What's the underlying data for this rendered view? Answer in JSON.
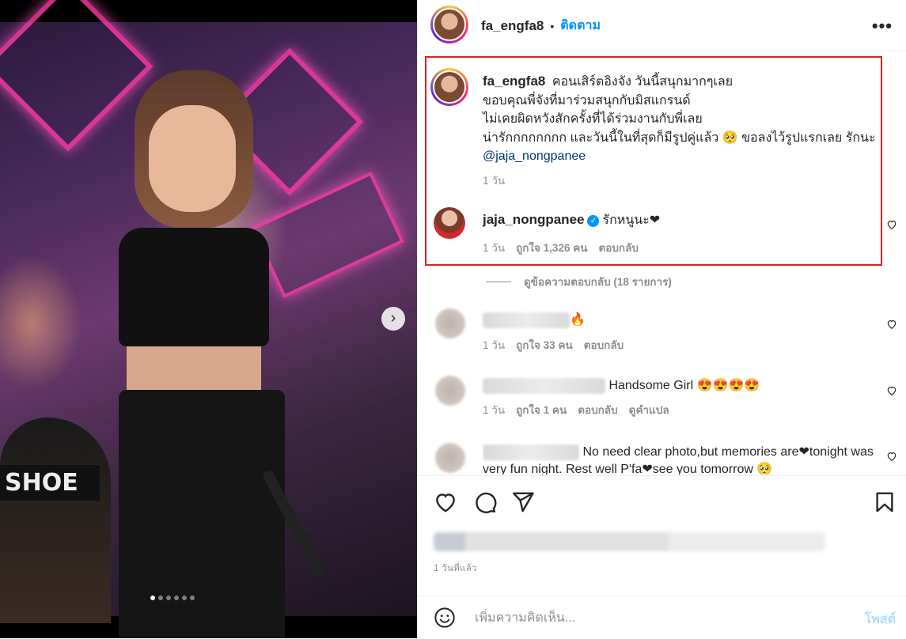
{
  "post": {
    "username": "fa_engfa8",
    "follow_label": "ติดตาม",
    "more_label": "•••",
    "header_dot": "•",
    "image_alt_text_hidden": "",
    "carousel": {
      "count": 6,
      "active": 0
    }
  },
  "caption": {
    "username": "fa_engfa8",
    "lines": [
      "คอนเสิร์ตอิงจัง วันนี้สนุกมากๆเลย",
      "ขอบคุณพี่จังที่มาร่วมสนุกกับมิสแกรนด์",
      "ไม่เคยผิดหวังสักครั้งที่ได้ร่วมงานกับพี่เลย",
      "น่ารักกกกกกกก และวันนี้ในที่สุดก็มีรูปคู่แล้ว 🥺 ขอลงไว้รูปแรกเลย รักนะ"
    ],
    "mention": "@jaja_nongpanee",
    "time": "1 วัน"
  },
  "pinned_comment": {
    "username": "jaja_nongpanee",
    "verified_mark": "✓",
    "text": "รักหนูนะ❤",
    "time": "1 วัน",
    "likes": "ถูกใจ 1,326 คน",
    "reply_label": "ตอบกลับ"
  },
  "view_replies": "ดูข้อความตอบกลับ (18 รายการ)",
  "comments": [
    {
      "text": "🔥",
      "time": "1 วัน",
      "likes": "ถูกใจ 33 คน",
      "reply_label": "ตอบกลับ"
    },
    {
      "text": "Handsome Girl 😍😍😍😍",
      "time": "1 วัน",
      "likes": "ถูกใจ 1 คน",
      "reply_label": "ตอบกลับ",
      "translate_label": "ดูคำแปล"
    },
    {
      "text": "No need clear photo,but memories are❤tonight was very fun night. Rest well P'fa❤see you tomorrow 🥺"
    }
  ],
  "footer": {
    "time_ago": "1 วันที่แล้ว",
    "add_comment_placeholder": "เพิ่มความคิดเห็น...",
    "post_label": "โพสต์"
  },
  "colors": {
    "accent": "#0095f6",
    "highlight_border": "#e0211d",
    "muted": "#8e8e8e"
  },
  "icons": [
    "more-icon",
    "heart-icon",
    "comment-icon",
    "share-icon",
    "bookmark-icon",
    "emoji-icon",
    "chevron-right-icon",
    "verified-icon"
  ]
}
